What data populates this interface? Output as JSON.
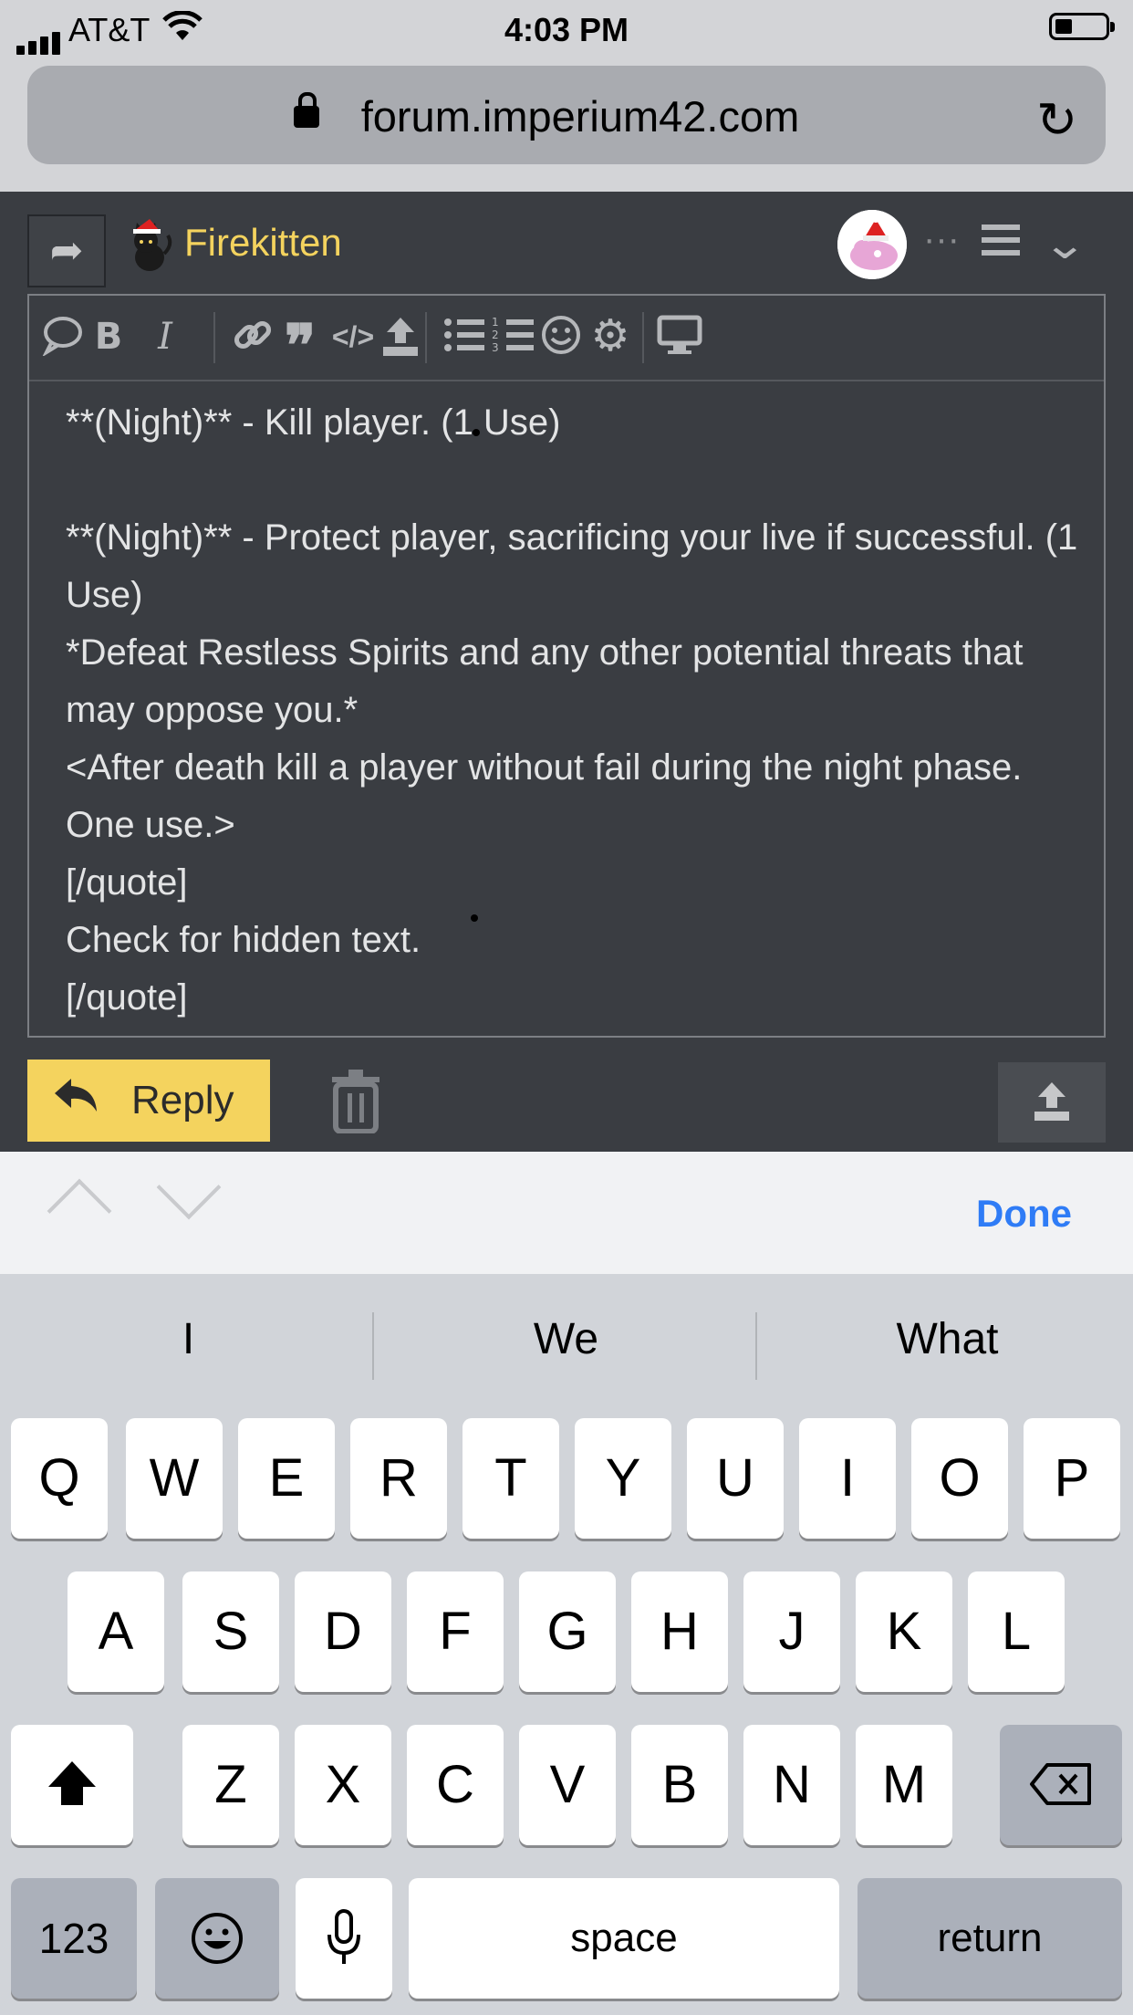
{
  "status_bar": {
    "carrier": "AT&T",
    "time": "4:03 PM",
    "signal_icon": "cellular-signal-icon",
    "wifi_icon": "wifi-icon",
    "battery_icon": "battery-icon"
  },
  "browser": {
    "url": "forum.imperium42.com",
    "lock_icon": "lock-icon",
    "reload_icon": "reload-icon"
  },
  "forum_header": {
    "username": "Firekitten",
    "username_color": "#f4d35e",
    "more": "···"
  },
  "editor": {
    "toolbar_icons": [
      "speech-bubble-icon",
      "bold-icon",
      "italic-icon",
      "link-icon",
      "quote-icon",
      "code-icon",
      "upload-icon",
      "bullet-list-icon",
      "numbered-list-icon",
      "emoji-icon",
      "gear-icon",
      "preview-icon"
    ],
    "content": "**(Night)** - Kill player. (1 Use)\n\n**(Night)** - Protect player, sacrificing your live if successful. (1 Use)\n*Defeat Restless Spirits and any other potential threats that may oppose you.*\n<After death kill a player without fail during the night phase. One use.>\n[/quote]\nCheck for hidden text.\n[/quote]"
  },
  "actions": {
    "reply_label": "Reply",
    "accent": "#f4d35e"
  },
  "accessory_bar": {
    "done_label": "Done",
    "done_color": "#2f7cf6"
  },
  "keyboard": {
    "suggestions": [
      "I",
      "We",
      "What"
    ],
    "row1": [
      "Q",
      "W",
      "E",
      "R",
      "T",
      "Y",
      "U",
      "I",
      "O",
      "P"
    ],
    "row2": [
      "A",
      "S",
      "D",
      "F",
      "G",
      "H",
      "J",
      "K",
      "L"
    ],
    "row3": [
      "Z",
      "X",
      "C",
      "V",
      "B",
      "N",
      "M"
    ],
    "numbers_label": "123",
    "space_label": "space",
    "return_label": "return"
  }
}
